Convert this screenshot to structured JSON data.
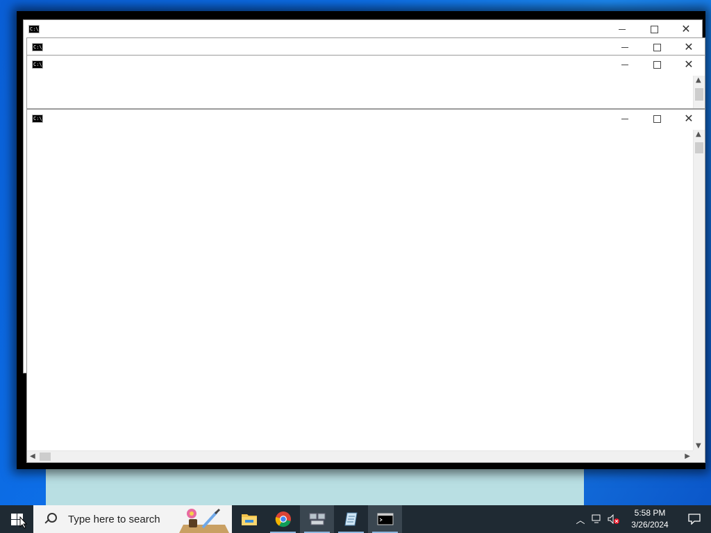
{
  "windows": [
    {
      "id": "w1",
      "title": ""
    },
    {
      "id": "w2",
      "title": ""
    },
    {
      "id": "w3",
      "title": ""
    },
    {
      "id": "w4",
      "title": ""
    }
  ],
  "icons": {
    "cmd": "cmd-icon",
    "minimize": "minimize-icon",
    "maximize": "maximize-icon",
    "close": "close-icon"
  },
  "cmd_icon_text": "C:\\_",
  "taskbar": {
    "search_placeholder": "Type here to search",
    "apps": [
      "file-explorer",
      "chrome",
      "network-tool",
      "notepad",
      "command-prompt"
    ],
    "clock_time": "5:58 PM",
    "clock_date": "3/26/2024"
  },
  "colors": {
    "desktop": "#0d6fe8",
    "taskbar": "#1f2a33"
  }
}
